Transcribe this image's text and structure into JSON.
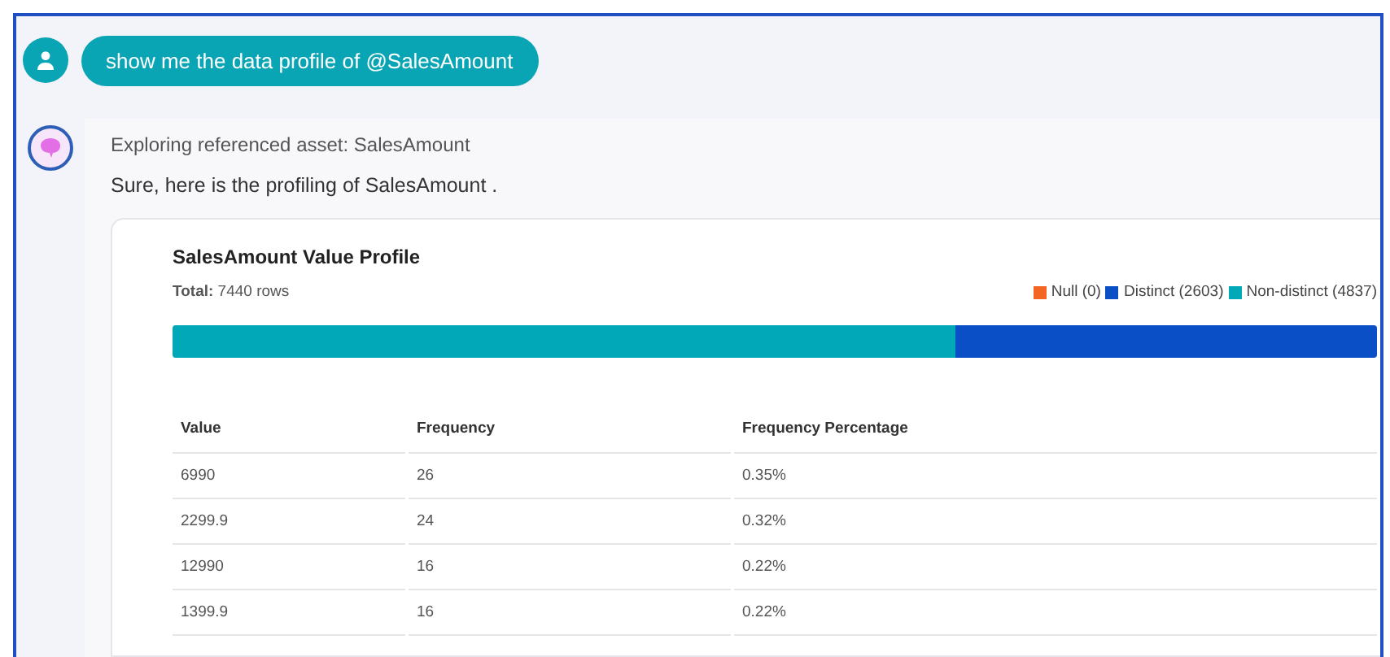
{
  "user_message": {
    "text": "show me the data profile of @SalesAmount"
  },
  "assistant": {
    "status": "Exploring referenced asset: SalesAmount",
    "reply": "Sure, here is the profiling of SalesAmount .",
    "profile": {
      "title": "SalesAmount Value Profile",
      "total_label": "Total:",
      "total_value": "7440 rows",
      "segments": [
        {
          "label": "Null (0)",
          "color": "#f26522",
          "level": 0
        },
        {
          "label": "Distinct (2603)",
          "color": "#0b4fc7",
          "level": 0.35
        },
        {
          "label": "Non-distinct (4837)",
          "color": "#00a8b8",
          "level": 0.65
        }
      ],
      "table": {
        "columns": [
          "Value",
          "Frequency",
          "Frequency Percentage"
        ],
        "rows": [
          [
            "6990",
            "26",
            "0.35%"
          ],
          [
            "2299.9",
            "24",
            "0.32%"
          ],
          [
            "12990",
            "16",
            "0.22%"
          ],
          [
            "1399.9",
            "16",
            "0.22%"
          ]
        ]
      }
    }
  }
}
